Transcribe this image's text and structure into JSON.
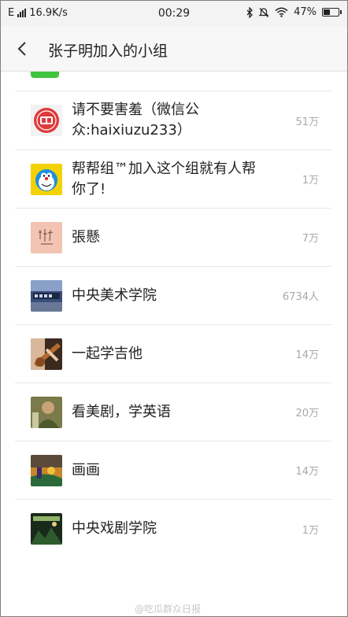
{
  "status_bar": {
    "network_type": "E",
    "speed": "16.9K/s",
    "time": "00:29",
    "battery_percent": "47%",
    "battery_level": 0.47
  },
  "header": {
    "back_icon": "chevron-left-icon",
    "title": "张子明加入的小组"
  },
  "groups": [
    {
      "name": "请不要害羞（微信公众:haixiuzu233）",
      "count": "51万",
      "avatar": "red-seal-logo"
    },
    {
      "name": "帮帮组™加入这个组就有人帮你了!",
      "count": "1万",
      "avatar": "doraemon"
    },
    {
      "name": "張懸",
      "count": "7万",
      "avatar": "pink-calligraphy"
    },
    {
      "name": "中央美术学院",
      "count": "6734人",
      "avatar": "academy-photo"
    },
    {
      "name": "一起学吉他",
      "count": "14万",
      "avatar": "guitar-photo"
    },
    {
      "name": "看美剧，学英语",
      "count": "20万",
      "avatar": "man-portrait"
    },
    {
      "name": "画画",
      "count": "14万",
      "avatar": "painting"
    },
    {
      "name": "中央戏剧学院",
      "count": "1万",
      "avatar": "theatre-photo"
    }
  ],
  "watermark": "@吃瓜群众日报"
}
